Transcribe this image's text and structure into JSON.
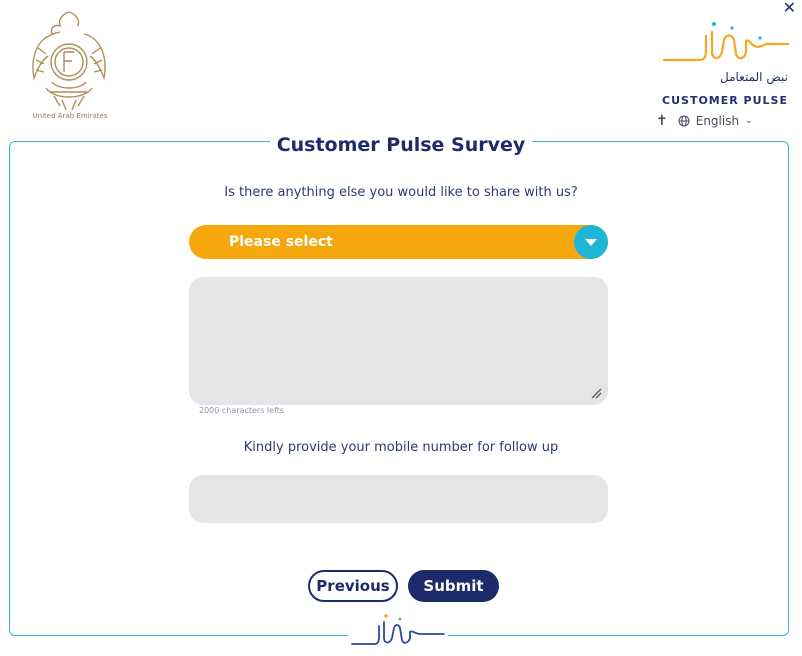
{
  "header": {
    "emblem_caption": "United Arab Emirates",
    "logo_arabic": "نبض المتعامل",
    "logo_english": "CUSTOMER PULSE",
    "language": "English",
    "icons": {
      "close": "close-icon",
      "accessibility": "accessibility-icon",
      "globe": "globe-icon",
      "chevron": "chevron-down-icon"
    }
  },
  "survey": {
    "title": "Customer Pulse Survey",
    "question": "Is there anything else you would like to share with us?",
    "select_value": "Please select",
    "textarea_value": "",
    "chars_left": "2000 characters lefts",
    "mobile_question": "Kindly provide your mobile number for follow up",
    "mobile_value": ""
  },
  "buttons": {
    "previous": "Previous",
    "submit": "Submit"
  },
  "colors": {
    "primary": "#1e2b6b",
    "accent_orange": "#f7a70e",
    "accent_cyan": "#1fb5d7",
    "border": "#31b7d8",
    "field_bg": "#e3e5e6",
    "emblem": "#9a7c4a"
  }
}
